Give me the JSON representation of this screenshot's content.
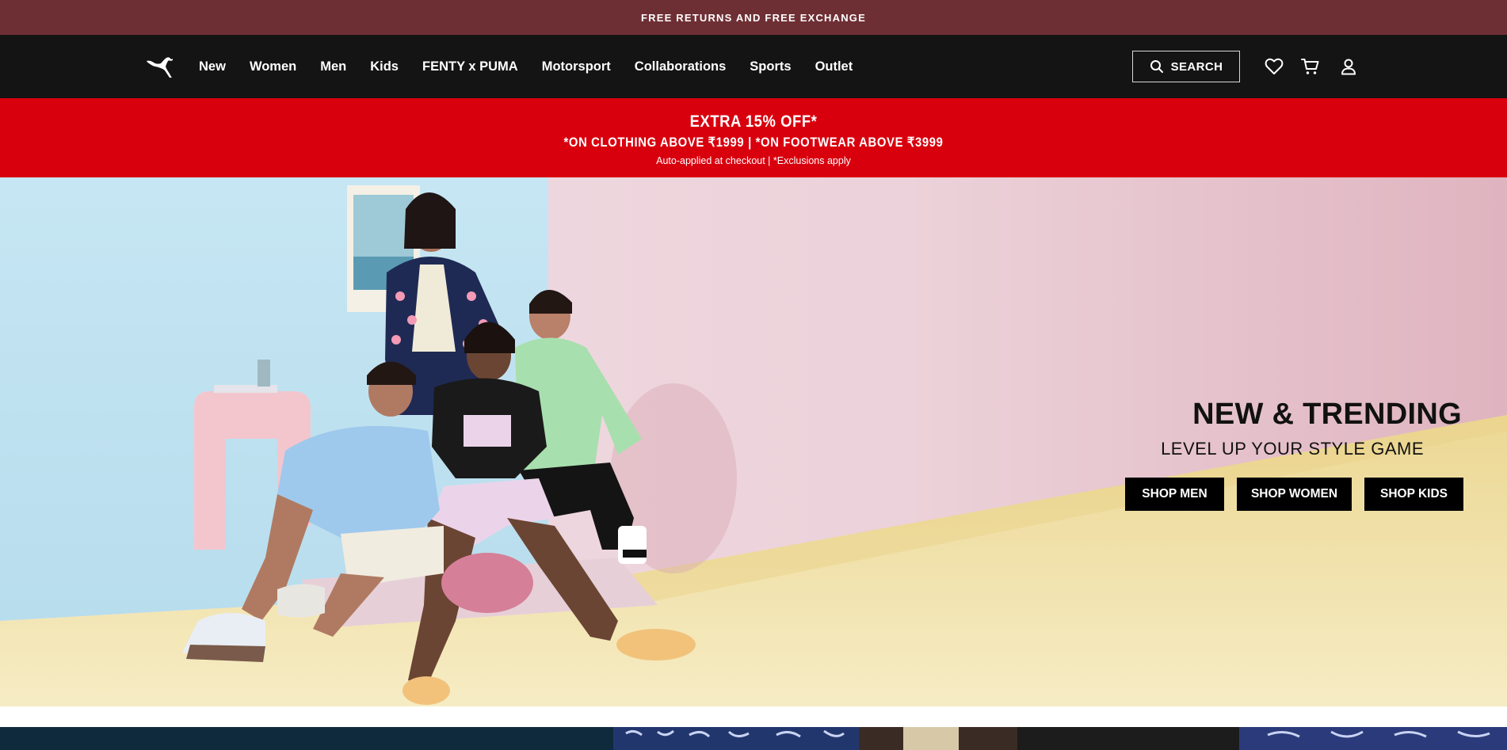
{
  "announcement": {
    "text": "FREE RETURNS AND FREE EXCHANGE"
  },
  "header": {
    "logo": "puma-logo",
    "nav": [
      {
        "label": "New"
      },
      {
        "label": "Women"
      },
      {
        "label": "Men"
      },
      {
        "label": "Kids"
      },
      {
        "label": "FENTY x PUMA"
      },
      {
        "label": "Motorsport"
      },
      {
        "label": "Collaborations"
      },
      {
        "label": "Sports"
      },
      {
        "label": "Outlet"
      }
    ],
    "search_label": "SEARCH",
    "icons": [
      "search-icon",
      "heart-icon",
      "cart-icon",
      "user-icon"
    ]
  },
  "promo": {
    "headline": "EXTRA 15% OFF*",
    "detail": "*ON CLOTHING ABOVE ₹1999 | *ON FOOTWEAR ABOVE ₹3999",
    "note": "Auto-applied at checkout | *Exclusions apply",
    "background": "#d9000e"
  },
  "hero": {
    "title": "NEW & TRENDING",
    "subtitle": "LEVEL UP YOUR STYLE GAME",
    "buttons": [
      {
        "label": "SHOP MEN"
      },
      {
        "label": "SHOP WOMEN"
      },
      {
        "label": "SHOP KIDS"
      }
    ]
  },
  "colors": {
    "announcement_bg": "#6e2f34",
    "nav_bg": "#141414",
    "accent": "#d9000e",
    "button_bg": "#000000"
  }
}
